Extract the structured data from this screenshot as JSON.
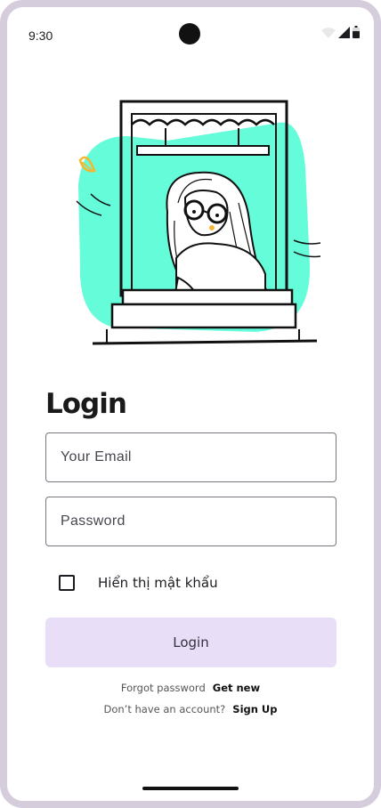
{
  "status_bar": {
    "time": "9:30",
    "icons": [
      "wifi-icon",
      "signal-icon",
      "battery-icon"
    ]
  },
  "illustration": {
    "description_icon": "girl-at-window-illustration",
    "accent_color": "#64fcd9"
  },
  "login": {
    "title": "Login",
    "email_placeholder": "Your Email",
    "password_placeholder": "Password",
    "show_password_label": "Hiển thị mật khẩu",
    "button_label": "Login",
    "forgot_text": "Forgot password",
    "forgot_link": "Get new",
    "signup_text": "Don’t have an account?",
    "signup_link": "Sign Up"
  },
  "colors": {
    "button_bg": "#e8def8",
    "frame": "#d5ccdc"
  }
}
